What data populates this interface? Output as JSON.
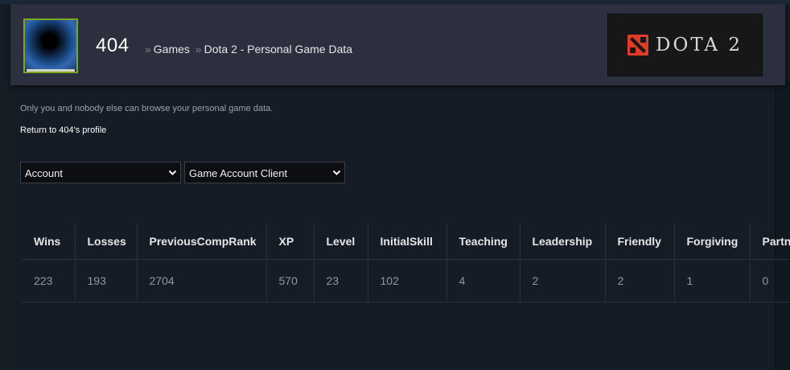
{
  "profile": {
    "name": "404"
  },
  "breadcrumb": {
    "separator": "»",
    "games": "Games",
    "current": "Dota 2 - Personal Game Data"
  },
  "game_logo": {
    "text": "DOTA 2",
    "accent_color": "#e03c28"
  },
  "notice": "Only you and nobody else can browse your personal game data.",
  "return_link": "Return to 404's profile",
  "filters": {
    "category": {
      "selected": "Account"
    },
    "table": {
      "selected": "Game Account Client"
    }
  },
  "stats_table": {
    "columns": [
      "Wins",
      "Losses",
      "PreviousCompRank",
      "XP",
      "Level",
      "InitialSkill",
      "Teaching",
      "Leadership",
      "Friendly",
      "Forgiving",
      "Partner"
    ],
    "rows": [
      [
        "223",
        "193",
        "2704",
        "570",
        "23",
        "102",
        "4",
        "2",
        "2",
        "1",
        "0"
      ]
    ]
  },
  "colors": {
    "page_bg": "#171d25",
    "header_bg": "#2c303e",
    "avatar_border": "#7ba81f",
    "text_muted": "#8f98a0"
  }
}
